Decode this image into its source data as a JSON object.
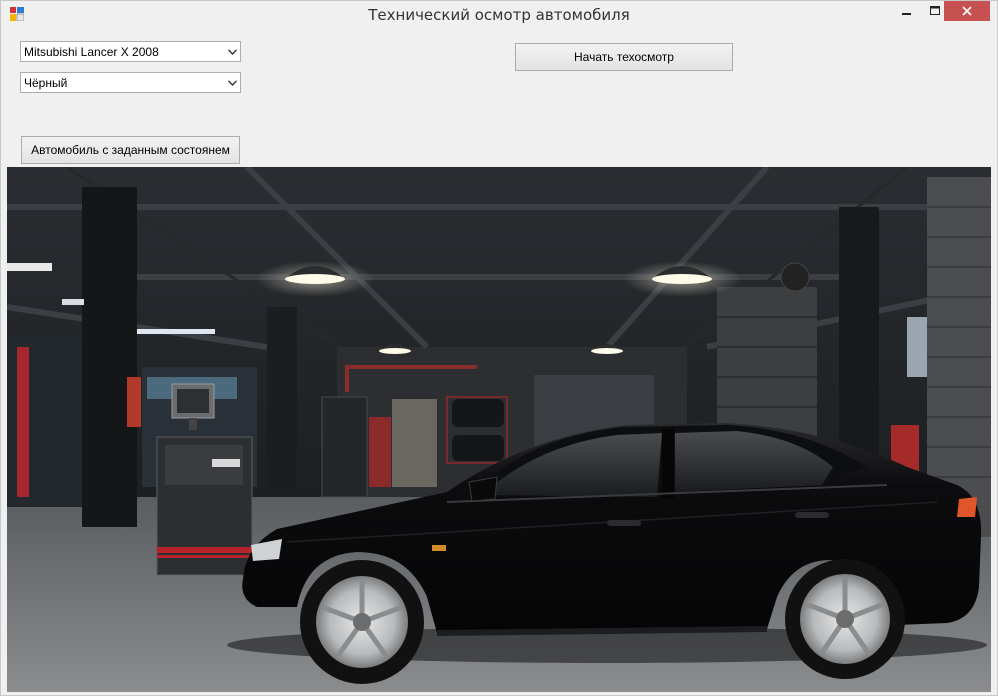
{
  "window": {
    "title": "Технический осмотр автомобиля"
  },
  "controls": {
    "model_select": {
      "value": "Mitsubishi Lancer X 2008"
    },
    "color_select": {
      "value": "Чёрный"
    },
    "start_button": {
      "label": "Начать техосмотр"
    },
    "preset_button": {
      "label": "Автомобиль с заданным состоянем"
    }
  },
  "scene": {
    "description_icon": "garage-with-car-image",
    "car_color": "#0b0b0d",
    "stripe_color": "#b8232b"
  },
  "colors": {
    "close_button": "#c75050",
    "window_bg": "#f0f0f0"
  }
}
